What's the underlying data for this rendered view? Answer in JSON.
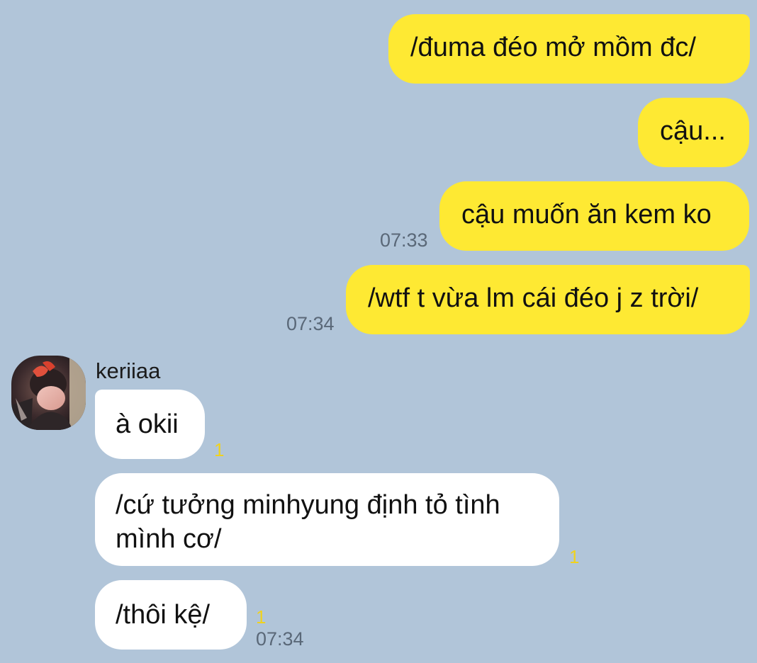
{
  "conversation": {
    "sent": [
      {
        "text": "/đuma đéo mở mồm đc/"
      },
      {
        "text": "cậu..."
      },
      {
        "text": "cậu muốn ăn kem ko",
        "time": "07:33"
      },
      {
        "text": "/wtf t vừa lm cái đéo j z trời/",
        "time": "07:34"
      }
    ],
    "contact": {
      "name": "keriiaa",
      "avatar_icon": "profile-photo"
    },
    "received": [
      {
        "text": "à okii",
        "unread": "1"
      },
      {
        "lines": [
          "/cứ tưởng minhyung định tỏ tình",
          "mình cơ/"
        ],
        "unread": "1"
      },
      {
        "text": "/thôi kệ/",
        "unread": "1",
        "time": "07:34"
      }
    ]
  },
  "colors": {
    "background": "#b1c5d9",
    "sent_bubble": "#fee933",
    "received_bubble": "#ffffff",
    "unread_count": "#f0d21e",
    "timestamp": "#5a6878"
  }
}
